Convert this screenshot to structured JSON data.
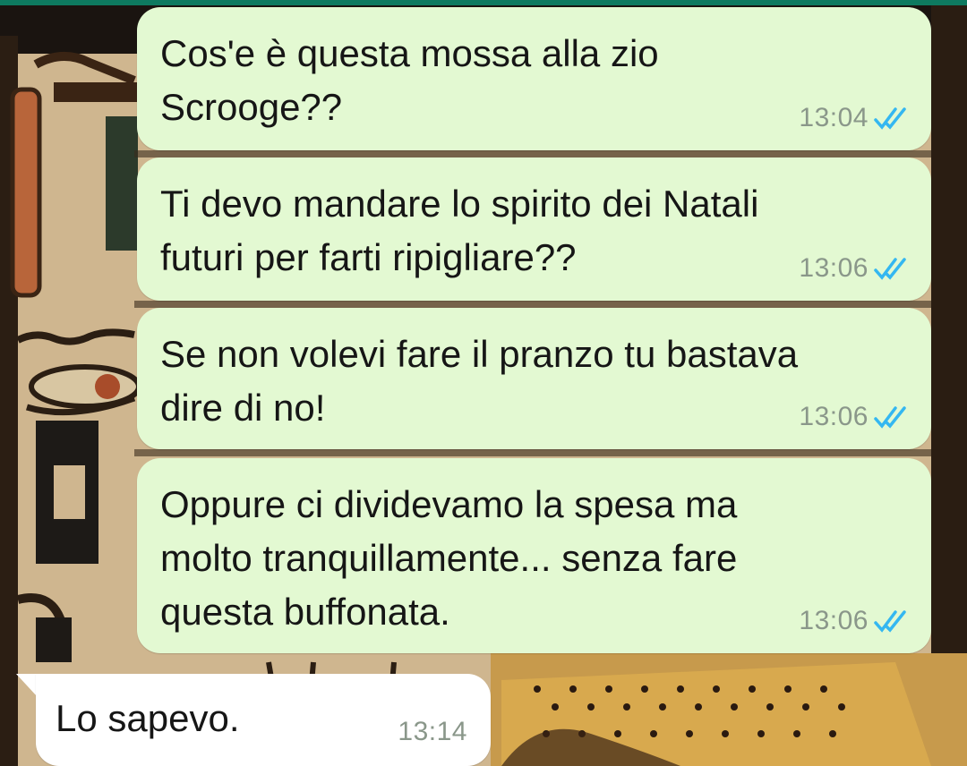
{
  "wallpaper": {
    "description_icon": "egyptian-mural-wallpaper"
  },
  "colors": {
    "outgoing_bubble": "#e3f9d2",
    "incoming_bubble": "#ffffff",
    "read_ticks": "#34b7f1",
    "top_bar": "#0e7a60"
  },
  "messages": [
    {
      "direction": "outgoing",
      "text": "Cos'e è questa mossa alla zio\nScrooge??",
      "time": "13:04",
      "status_icon": "double-check-read-icon"
    },
    {
      "direction": "outgoing",
      "text": "Ti devo mandare lo spirito dei Natali\nfuturi per farti ripigliare??",
      "time": "13:06",
      "status_icon": "double-check-read-icon"
    },
    {
      "direction": "outgoing",
      "text": "Se non volevi fare il pranzo tu bastava\ndire di no!",
      "time": "13:06",
      "status_icon": "double-check-read-icon"
    },
    {
      "direction": "outgoing",
      "text": "Oppure ci dividevamo la spesa ma\nmolto tranquillamente... senza fare\nquesta buffonata.",
      "time": "13:06",
      "status_icon": "double-check-read-icon"
    },
    {
      "direction": "incoming",
      "text": "Lo sapevo.",
      "time": "13:14"
    }
  ]
}
